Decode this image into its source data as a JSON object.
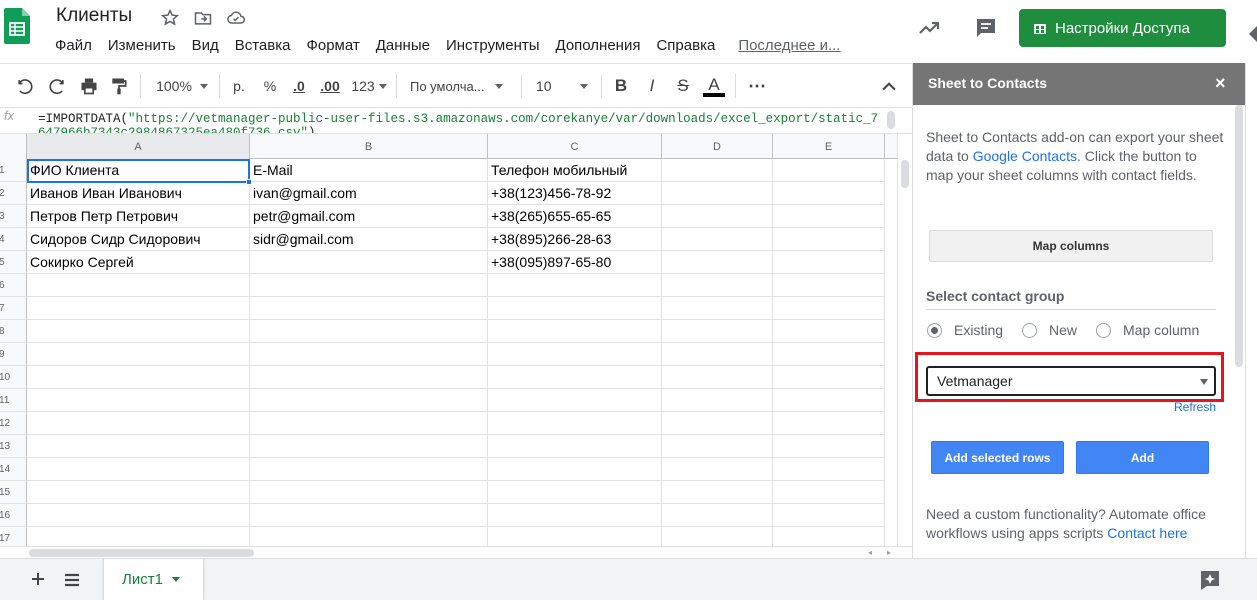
{
  "header": {
    "title": "Клиенты",
    "menu": [
      "Файл",
      "Изменить",
      "Вид",
      "Вставка",
      "Формат",
      "Данные",
      "Инструменты",
      "Дополнения",
      "Справка"
    ],
    "last_edit": "Последнее и...",
    "share_label": "Настройки Доступа"
  },
  "toolbar": {
    "zoom": "100%",
    "currency": "р.",
    "percent": "%",
    "dec_less": ".0",
    "dec_more": ".00",
    "more_formats": "123",
    "font": "По умолча...",
    "font_size": "10",
    "bold": "B",
    "italic": "I",
    "strike": "S",
    "text_color": "A",
    "more": "⋯"
  },
  "formula_bar": {
    "fx": "fx",
    "prefix": "=IMPORTDATA(",
    "string": "\"https://vetmanager-public-user-files.s3.amazonaws.com/corekanye/var/downloads/excel_export/static_7647966b7343c2984867325ea480f736.csv\"",
    "suffix": ")"
  },
  "grid": {
    "columns": [
      "A",
      "B",
      "C",
      "D",
      "E"
    ],
    "row_numbers": [
      "1",
      "2",
      "3",
      "4",
      "5",
      "6",
      "7",
      "8",
      "9",
      "10",
      "11",
      "12",
      "13",
      "14",
      "15",
      "16",
      "17"
    ],
    "rows": [
      [
        "ФИО Клиента",
        "E-Mail",
        "Телефон мобильный",
        "",
        ""
      ],
      [
        "Иванов Иван Иванович",
        "ivan@gmail.com",
        "+38(123)456-78-92",
        "",
        ""
      ],
      [
        "Петров Петр Петрович",
        "petr@gmail.com",
        "+38(265)655-65-65",
        "",
        ""
      ],
      [
        "Сидоров Сидр Сидорович",
        "sidr@gmail.com",
        "+38(895)266-28-63",
        "",
        ""
      ],
      [
        "Сокирко Сергей",
        "",
        "+38(095)897-65-80",
        "",
        ""
      ]
    ]
  },
  "sheet_tab": "Лист1",
  "sidebar": {
    "title": "Sheet to Contacts",
    "close": "×",
    "desc_1": "Sheet to Contacts add-on can export your sheet data to ",
    "desc_link": "Google Contacts",
    "desc_2": ". Click the button to map your sheet columns with contact fields.",
    "map_columns": "Map columns",
    "group_label": "Select contact group",
    "radio_options": [
      "Existing",
      "New",
      "Map column"
    ],
    "radio_selected": "Existing",
    "selected_group": "Vetmanager",
    "refresh": "Refresh",
    "add_selected_rows": "Add selected rows",
    "add": "Add",
    "footer_text": "Need a custom functionality? Automate office workflows using apps scripts ",
    "footer_link": "Contact here"
  },
  "colors": {
    "share_green": "#1e8e3e",
    "selection_blue": "#1a73e8",
    "sidebar_header": "#757575",
    "highlight_red": "#e8141c",
    "button_blue": "#4285f4"
  }
}
